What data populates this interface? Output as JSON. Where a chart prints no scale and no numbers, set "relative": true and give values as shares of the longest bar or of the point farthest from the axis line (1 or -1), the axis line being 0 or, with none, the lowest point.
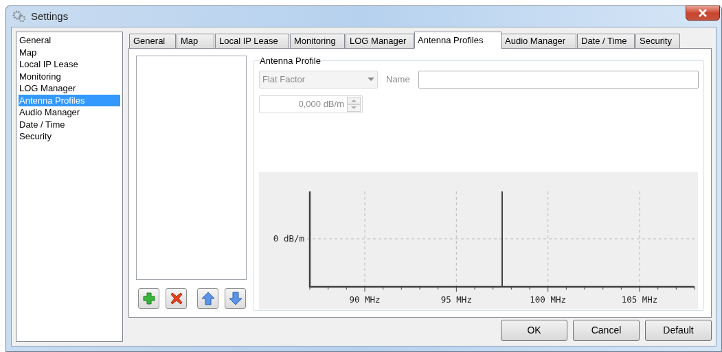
{
  "window": {
    "title": "Settings"
  },
  "sidebar": {
    "items": [
      {
        "label": "General",
        "selected": false
      },
      {
        "label": "Map",
        "selected": false
      },
      {
        "label": "Local IP Lease",
        "selected": false
      },
      {
        "label": "Monitoring",
        "selected": false
      },
      {
        "label": "LOG Manager",
        "selected": false
      },
      {
        "label": "Antenna Profiles",
        "selected": true
      },
      {
        "label": "Audio Manager",
        "selected": false
      },
      {
        "label": "Date / Time",
        "selected": false
      },
      {
        "label": "Security",
        "selected": false
      }
    ]
  },
  "tabs": [
    {
      "label": "General",
      "selected": false
    },
    {
      "label": "Map",
      "selected": false
    },
    {
      "label": "Local IP Lease",
      "selected": false
    },
    {
      "label": "Monitoring",
      "selected": false
    },
    {
      "label": "LOG Manager",
      "selected": false
    },
    {
      "label": "Antenna Profiles",
      "selected": true
    },
    {
      "label": "Audio Manager",
      "selected": false
    },
    {
      "label": "Date / Time",
      "selected": false
    },
    {
      "label": "Security",
      "selected": false
    }
  ],
  "profile_list_buttons": [
    {
      "kind": "add"
    },
    {
      "kind": "delete"
    },
    {
      "kind": "up"
    },
    {
      "kind": "down"
    }
  ],
  "antenna_profile": {
    "title": "Antenna Profile",
    "type_combo": {
      "value": "Flat Factor",
      "disabled": true
    },
    "name_label": "Name",
    "factor_spin": {
      "value": "0,000 dB/m",
      "disabled": true
    },
    "chart_data": {
      "type": "line",
      "xlim": [
        87,
        108
      ],
      "relative": true,
      "x": [
        97.5,
        97.5
      ],
      "grid": true,
      "series": [
        {
          "color": "#404040",
          "values": [
            0,
            1
          ]
        }
      ],
      "xticks": [
        {
          "value": 90,
          "label": "90 MHz"
        },
        {
          "value": 95,
          "label": "95 MHz"
        },
        {
          "value": 100,
          "label": "100 MHz"
        },
        {
          "value": 105,
          "label": "105 MHz"
        }
      ],
      "annotations": [
        {
          "text": "0 dB/m"
        }
      ]
    }
  },
  "buttons": [
    "OK",
    "Cancel",
    "Default"
  ]
}
